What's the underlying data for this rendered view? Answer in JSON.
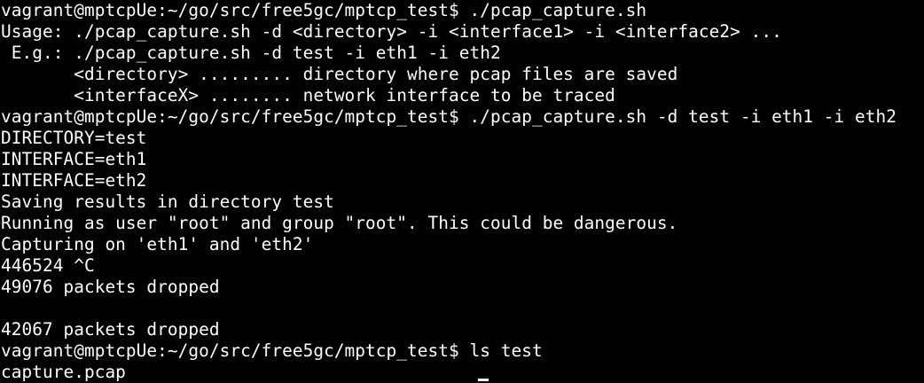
{
  "terminal": {
    "lines": [
      "vagrant@mptcpUe:~/go/src/free5gc/mptcp_test$ ./pcap_capture.sh",
      "Usage: ./pcap_capture.sh -d <directory> -i <interface1> -i <interface2> ...",
      " E.g.: ./pcap_capture.sh -d test -i eth1 -i eth2",
      "       <directory> ......... directory where pcap files are saved",
      "       <interfaceX> ........ network interface to be traced",
      "vagrant@mptcpUe:~/go/src/free5gc/mptcp_test$ ./pcap_capture.sh -d test -i eth1 -i eth2",
      "DIRECTORY=test",
      "INTERFACE=eth1",
      "INTERFACE=eth2",
      "Saving results in directory test",
      "Running as user \"root\" and group \"root\". This could be dangerous.",
      "Capturing on 'eth1' and 'eth2'",
      "446524 ^C",
      "49076 packets dropped",
      "",
      "42067 packets dropped",
      "vagrant@mptcpUe:~/go/src/free5gc/mptcp_test$ ls test",
      "capture.pcap"
    ]
  },
  "colors": {
    "background": "#000000",
    "foreground": "#ffffff"
  }
}
